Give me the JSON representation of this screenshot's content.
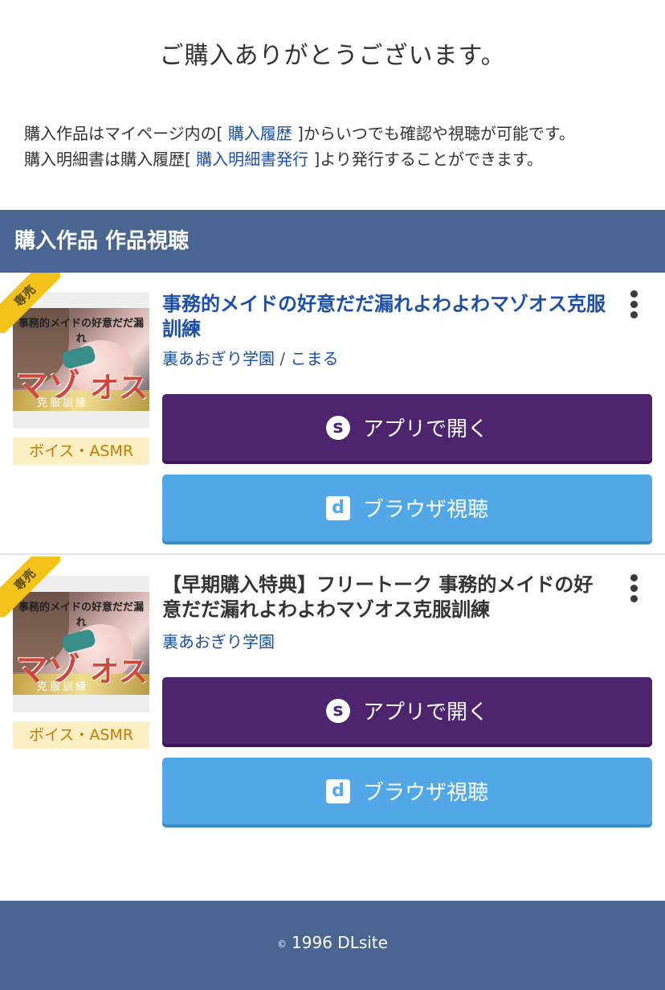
{
  "thanks": "ご購入ありがとうございます。",
  "info": {
    "line1_pre": "購入作品はマイページ内の[ ",
    "line1_link": "購入履歴",
    "line1_post": " ]からいつでも確認や視聴が可能です。",
    "line2_pre": "購入明細書は購入履歴[ ",
    "line2_link": "購入明細書発行",
    "line2_post": " ]より発行することができます。"
  },
  "section_title": "購入作品 作品視聴",
  "items": [
    {
      "ribbon": "専売",
      "thumb_title": "事務的メイドの好意だだ漏れ",
      "thumb_big": "マゾ",
      "thumb_big2": "オス",
      "thumb_sub": "克服訓練",
      "genre": "ボイス・ASMR",
      "title": "事務的メイドの好意だだ漏れよわよわマゾオス克服訓練",
      "circle": "裏あおぎり学園",
      "separator": "/",
      "author": "こまる",
      "app_button": "アプリで開く",
      "browser_button": "ブラウザ視聴"
    },
    {
      "ribbon": "専売",
      "thumb_title": "事務的メイドの好意だだ漏れ",
      "thumb_big": "マゾ",
      "thumb_big2": "オス",
      "thumb_sub": "克服訓練",
      "genre": "ボイス・ASMR",
      "title": "【早期購入特典】フリートーク 事務的メイドの好意だだ漏れよわよわマゾオス克服訓練",
      "circle": "裏あおぎり学園",
      "app_button": "アプリで開く",
      "browser_button": "ブラウザ視聴"
    }
  ],
  "icons": {
    "app": "s",
    "browser": "d"
  },
  "footer": {
    "copyright_symbol": "©",
    "text": "1996 DLsite"
  },
  "colors": {
    "header_bg": "#4b6593",
    "link": "#1b4fa8",
    "app_button": "#4f246e",
    "browser_button": "#52a8e6",
    "ribbon": "#f3c21b",
    "genre_bg": "#fdefc4",
    "genre_text": "#c47b00"
  }
}
